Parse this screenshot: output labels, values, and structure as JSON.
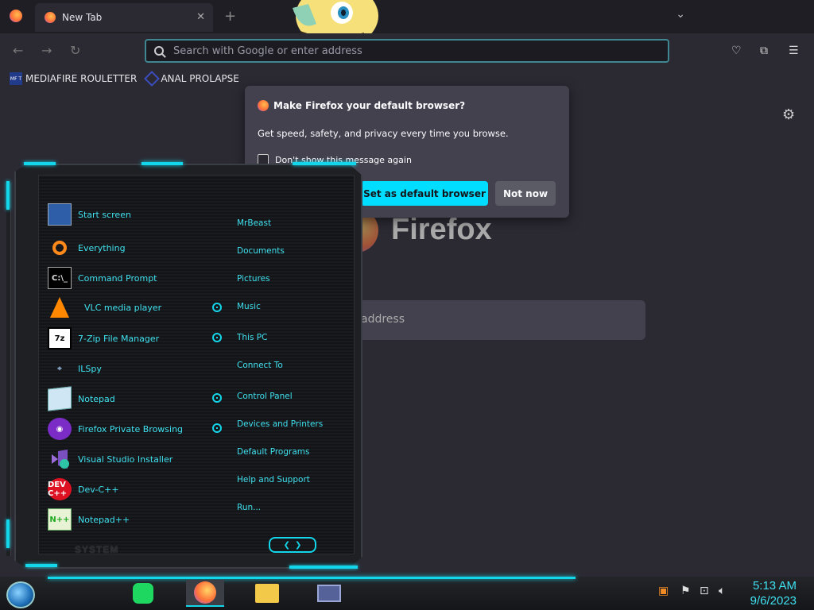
{
  "browser": {
    "tab_title": "New Tab",
    "tab_close": "✕",
    "new_tab_symbol": "+",
    "tab_list_symbol": "⌄",
    "url_placeholder": "Search with Google or enter address",
    "bookmarks": [
      {
        "label": "MEDIAFIRE ROULETTER",
        "icon": "mf-icon",
        "icon_text": "MF\nT"
      },
      {
        "label": "ANAL PROLAPSE",
        "icon": "diamond-bookmark-icon"
      }
    ]
  },
  "newtab": {
    "wordmark": "Firefox",
    "search_placeholder": "address"
  },
  "popup": {
    "title": "Make Firefox your default browser?",
    "body": "Get speed, safety, and privacy every time you browse.",
    "checkbox_label": "Don't show this message again",
    "primary_button": "Set as default browser",
    "secondary_button": "Not now",
    "accent_color": "#00ddff"
  },
  "start_menu": {
    "programs": [
      {
        "label": "Start screen",
        "icon": "start-screen-icon"
      },
      {
        "label": "Everything",
        "icon": "everything-icon"
      },
      {
        "label": "Command Prompt",
        "icon": "command-prompt-icon",
        "icon_text": "C:\\_"
      },
      {
        "label": "VLC media player",
        "icon": "vlc-icon"
      },
      {
        "label": "7-Zip File Manager",
        "icon": "7zip-icon",
        "icon_text": "7z"
      },
      {
        "label": "ILSpy",
        "icon": "ilspy-icon"
      },
      {
        "label": "Notepad",
        "icon": "notepad-icon"
      },
      {
        "label": "Firefox Private Browsing",
        "icon": "firefox-private-icon"
      },
      {
        "label": "Visual Studio Installer",
        "icon": "visual-studio-icon"
      },
      {
        "label": "Dev-C++",
        "icon": "dev-cpp-icon",
        "icon_text": "DEV C++"
      },
      {
        "label": "Notepad++",
        "icon": "notepad-plus-plus-icon",
        "icon_text": "N++"
      }
    ],
    "places": [
      "MrBeast",
      "Documents",
      "Pictures",
      "Music",
      "This PC",
      "Connect To",
      "Control Panel",
      "Devices and Printers",
      "Default Programs",
      "Help and Support",
      "Run..."
    ],
    "system_label": "SYSTEM",
    "nav_left": "❮",
    "nav_right": "❯",
    "accent_color": "#13d6ea"
  },
  "taskbar": {
    "pinned": [
      "spotify-icon",
      "firefox-icon",
      "file-explorer-icon",
      "window-app-icon"
    ],
    "time": "5:13 AM",
    "date": "9/6/2023"
  }
}
